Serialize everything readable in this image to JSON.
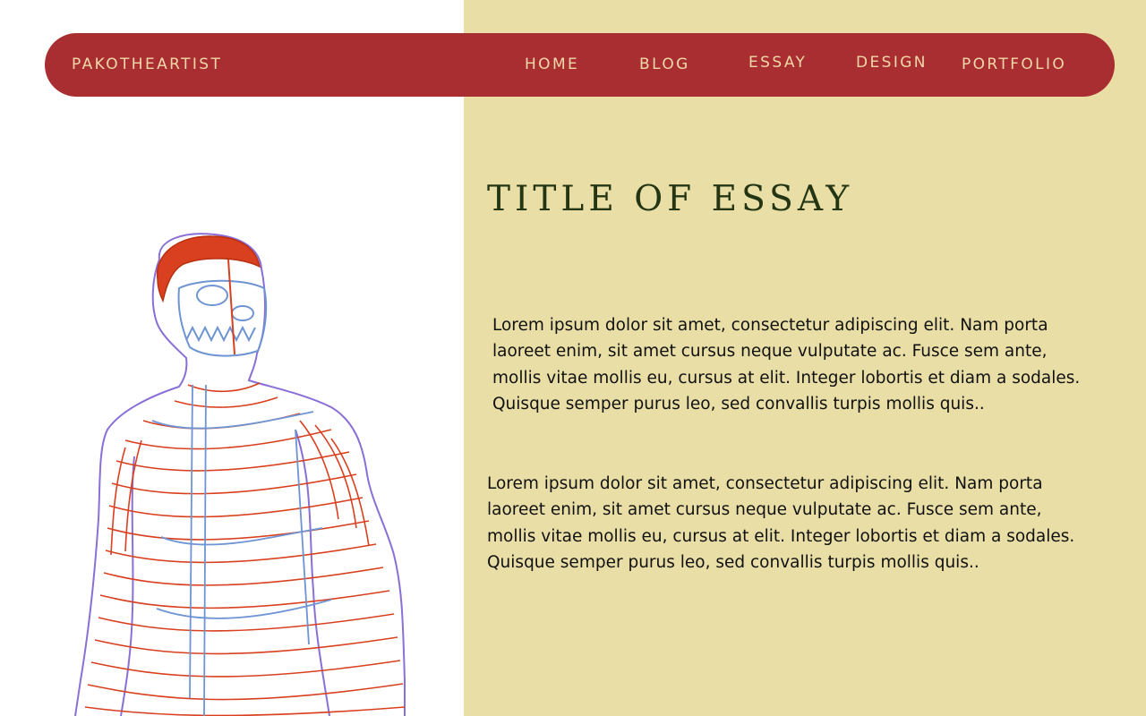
{
  "nav": {
    "brand": "PAKOTHEARTIST",
    "items": [
      {
        "label": "HOME"
      },
      {
        "label": "BLOG"
      },
      {
        "label": "ESSAY"
      },
      {
        "label": "DESIGN"
      },
      {
        "label": "PORTFOLIO"
      }
    ]
  },
  "essay": {
    "title": "TITLE OF ESSAY",
    "paragraphs": [
      "Lorem ipsum dolor sit amet, consectetur adipiscing elit. Nam porta laoreet enim, sit amet cursus neque vulputate ac. Fusce sem ante, mollis vitae mollis eu, cursus at elit. Integer lobortis et diam a sodales. Quisque semper purus leo, sed convallis turpis mollis quis..",
      "Lorem ipsum dolor sit amet, consectetur adipiscing elit. Nam porta laoreet enim, sit amet cursus neque vulputate ac. Fusce sem ante, mollis vitae mollis eu, cursus at elit. Integer lobortis et diam a sodales. Quisque semper purus leo, sed convallis turpis mollis quis.."
    ]
  },
  "illustration": {
    "icon": "anatomy-sketch-illustration"
  },
  "colors": {
    "nav_bg": "#a82e31",
    "nav_text": "#f2d8a8",
    "right_bg": "#e8dea6",
    "title": "#233512",
    "sketch_red": "#d9401f",
    "sketch_blue": "#6f94d3",
    "sketch_purple": "#8a6fd6"
  }
}
